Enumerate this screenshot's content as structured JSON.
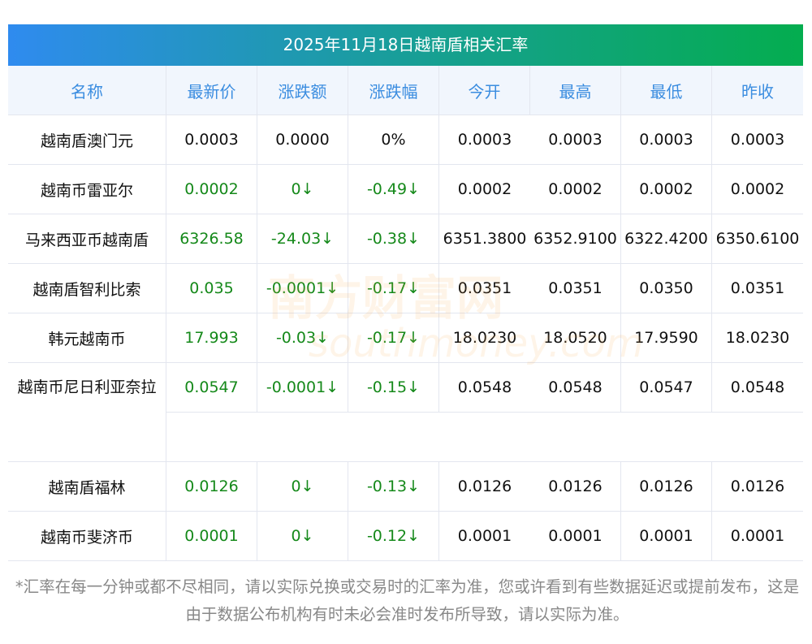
{
  "title": "2025年11月18日越南盾相关汇率",
  "headers": [
    "名称",
    "最新价",
    "涨跌额",
    "涨跌幅",
    "今开",
    "最高",
    "最低",
    "昨收"
  ],
  "rows": [
    [
      "越南盾澳门元",
      "0.0003",
      "0.0000",
      "0%",
      "0.0003",
      "0.0003",
      "0.0003",
      "0.0003"
    ],
    [
      "越南币雷亚尔",
      "0.0002",
      "0↓",
      "-0.49↓",
      "0.0002",
      "0.0002",
      "0.0002",
      "0.0002"
    ],
    [
      "马来西亚币越南盾",
      "6326.58",
      "-24.03↓",
      "-0.38↓",
      "6351.3800",
      "6352.9100",
      "6322.4200",
      "6350.6100"
    ],
    [
      "越南盾智利比索",
      "0.035",
      "-0.0001↓",
      "-0.17↓",
      "0.0351",
      "0.0351",
      "0.0350",
      "0.0351"
    ],
    [
      "韩元越南币",
      "17.993",
      "-0.03↓",
      "-0.17↓",
      "18.0230",
      "18.0520",
      "17.9590",
      "18.0230"
    ],
    [
      "越南币尼日利亚奈拉",
      "0.0547",
      "-0.0001↓",
      "-0.15↓",
      "0.0548",
      "0.0548",
      "0.0547",
      "0.0548"
    ],
    [
      "越南盾福林",
      "0.0126",
      "0↓",
      "-0.13↓",
      "0.0126",
      "0.0126",
      "0.0126",
      "0.0126"
    ],
    [
      "越南币斐济币",
      "0.0001",
      "0↓",
      "-0.12↓",
      "0.0001",
      "0.0001",
      "0.0001",
      "0.0001"
    ]
  ],
  "green_rows": [
    false,
    true,
    true,
    true,
    true,
    true,
    true,
    true
  ],
  "watermark": "南方财富网 southmoney.com",
  "note": "*汇率在每一分钟或都不尽相同，请以实际兑换或交易时的汇率为准，您或许看到有些数据延迟或提前发布，这是由于数据公布机构有时未必会准时发布所导致，请以实际为准。"
}
